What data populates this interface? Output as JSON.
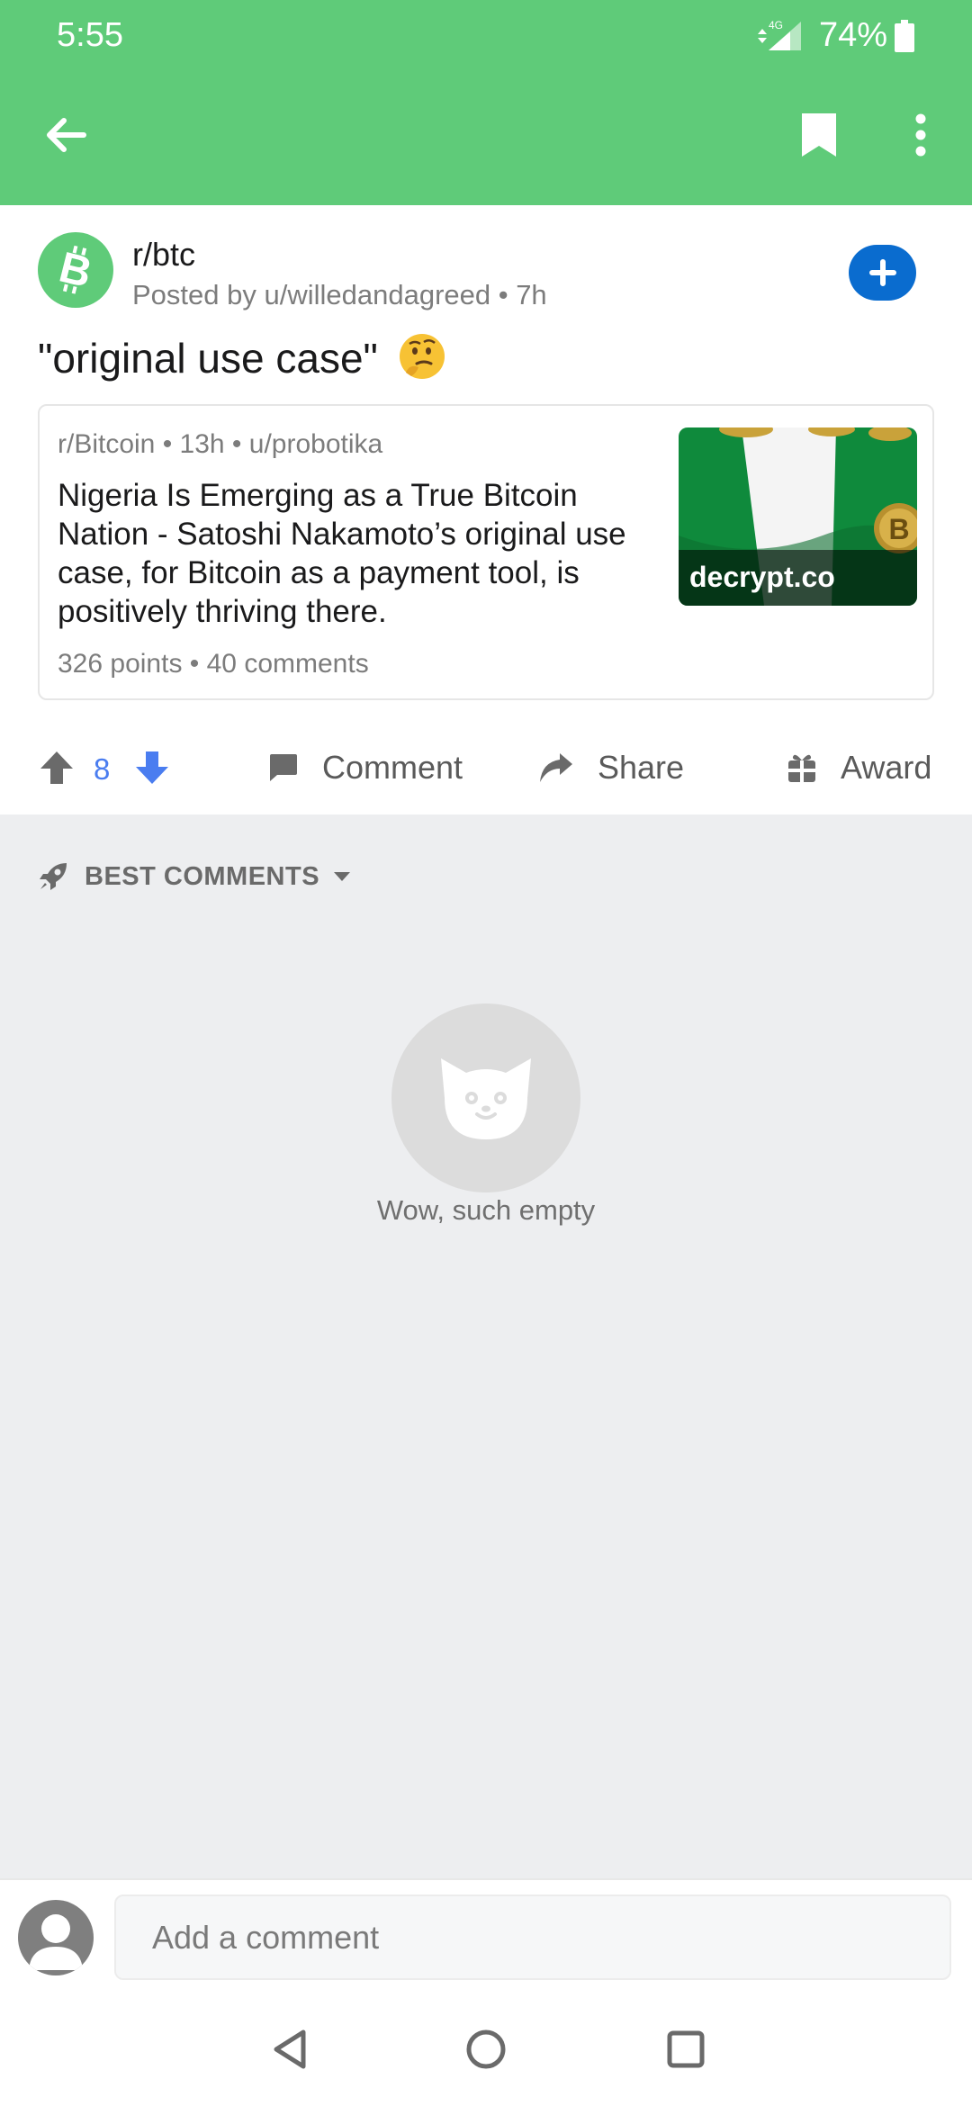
{
  "status_bar": {
    "time": "5:55",
    "network": "4G",
    "battery": "74%"
  },
  "toolbar": {
    "back_icon": "arrow-left-icon",
    "bookmark_icon": "bookmark-icon",
    "more_icon": "more-vertical-icon"
  },
  "post": {
    "subreddit": "r/btc",
    "posted_by": "Posted by u/willedandagreed • 7h",
    "title": "\"original use case\"",
    "title_emoji": "thinking-face-emoji"
  },
  "crosspost": {
    "meta": "r/Bitcoin • 13h • u/probotika",
    "title": "Nigeria Is Emerging as a True Bitcoin Nation - Satoshi Nakamoto’s original use case, for Bitcoin as a payment tool, is positively thriving there.",
    "stats": "326 points • 40 comments",
    "thumb_label": "decrypt.co"
  },
  "actions": {
    "score": "8",
    "comment_label": "Comment",
    "share_label": "Share",
    "award_label": "Award"
  },
  "comments": {
    "sort_label": "BEST COMMENTS",
    "empty_text": "Wow, such empty"
  },
  "composer": {
    "placeholder": "Add a comment"
  },
  "colors": {
    "brand_green": "#5fcb79",
    "join_blue": "#0a6ccf",
    "score_blue": "#4a7df0"
  }
}
